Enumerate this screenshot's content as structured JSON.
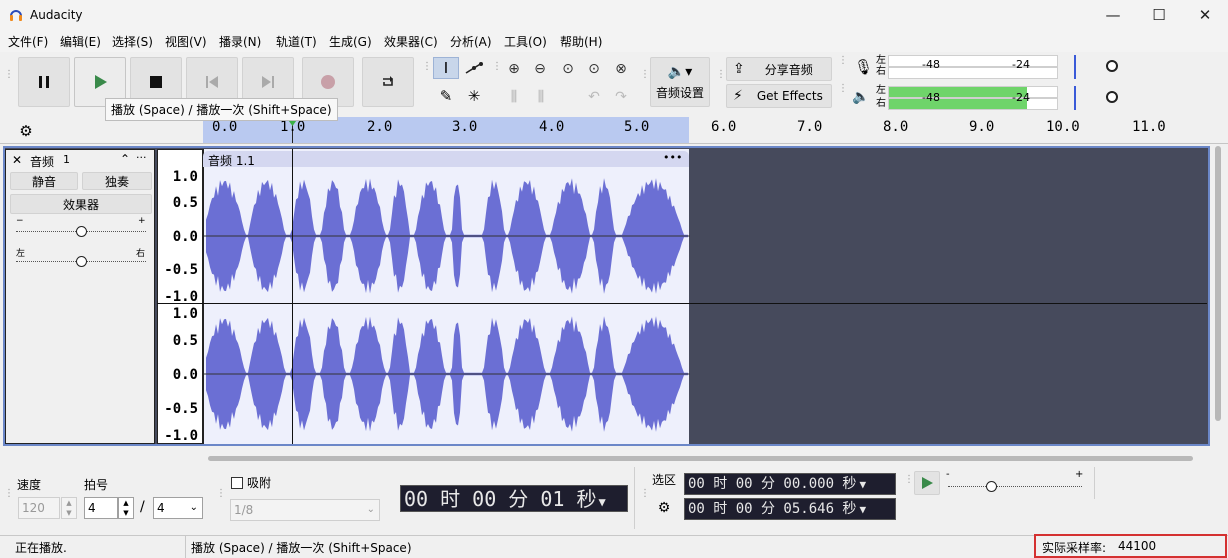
{
  "app": {
    "title": "Audacity"
  },
  "window_controls": {
    "minimize": "—",
    "maximize": "☐",
    "close": "✕"
  },
  "menu": [
    "文件(F)",
    "编辑(E)",
    "选择(S)",
    "视图(V)",
    "播录(N)",
    "轨道(T)",
    "生成(G)",
    "效果器(C)",
    "分析(A)",
    "工具(O)",
    "帮助(H)"
  ],
  "toolbar": {
    "tooltip": "播放 (Space) / 播放一次 (Shift+Space)",
    "audio_setup_label": "音频设置",
    "share_label": "分享音频",
    "get_effects_label": "Get Effects"
  },
  "meters": {
    "record": {
      "left": "左",
      "right": "右",
      "marks": [
        "-48",
        "-24"
      ]
    },
    "playback": {
      "left": "左",
      "right": "右",
      "marks": [
        "-48",
        "-24"
      ],
      "level_fraction": 0.82
    }
  },
  "ruler": {
    "ticks": [
      "0.0",
      "1.0",
      "2.0",
      "3.0",
      "4.0",
      "5.0",
      "6.0",
      "7.0",
      "8.0",
      "9.0",
      "10.0",
      "11.0"
    ]
  },
  "track": {
    "name": "音频",
    "number": "1",
    "mute_label": "静音",
    "solo_label": "独奏",
    "effects_label": "效果器",
    "gain_min": "−",
    "gain_max": "+",
    "pan_left": "左",
    "pan_right": "右",
    "clip_name": "音频 1.1",
    "clip_menu": "•••",
    "scale": [
      "1.0",
      "0.5",
      "0.0",
      "-0.5",
      "-1.0"
    ]
  },
  "bottom": {
    "tempo_label": "速度",
    "tempo_value": "120",
    "beats_label": "拍号",
    "beats_upper": "4",
    "beats_sep": "/",
    "beats_lower": "4",
    "snap_label": "吸附",
    "snap_value": "1/8",
    "time_display": "00 时 00 分 01 秒",
    "selection_label": "选区",
    "sel_start": "00 时 00 分 00.000 秒",
    "sel_end": "00 时 00 分 05.646 秒",
    "speed_min": "-",
    "speed_max": "+"
  },
  "status": {
    "state": "正在播放.",
    "hint": "播放 (Space) / 播放一次 (Shift+Space)",
    "rate_label": "实际采样率:",
    "rate_value": "44100"
  }
}
